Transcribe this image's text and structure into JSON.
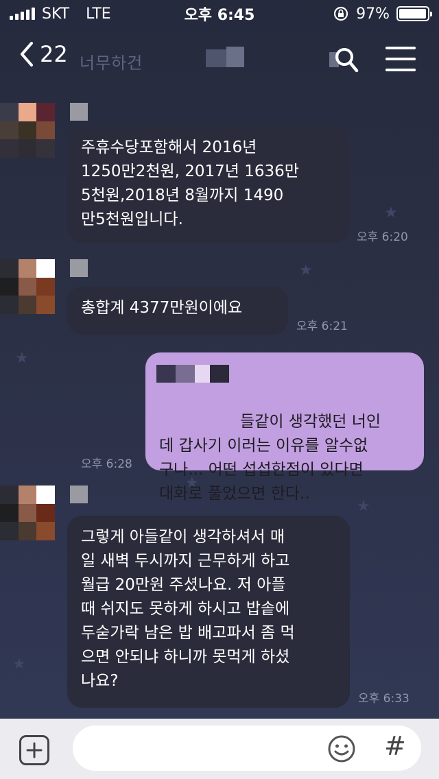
{
  "status_bar": {
    "carrier": "SKT",
    "network": "LTE",
    "time": "오후 6:45",
    "battery_label": "97%",
    "battery_level": 0.97
  },
  "nav": {
    "back_count": "22",
    "title": "너무하건"
  },
  "messages": [
    {
      "direction": "incoming",
      "text": "주휴수당포함해서 2016년\n1250만2천원, 2017년 1636만\n5천원,2018년 8월까지 1490\n만5천원입니다.",
      "time": "오후 6:20"
    },
    {
      "direction": "incoming",
      "text": "총합계 4377만원이에요",
      "time": "오후 6:21"
    },
    {
      "direction": "outgoing",
      "text": "들같이 생각했던 너인\n데 갑사기 이러는 이유를 알수없\n구나... 어떤 섭섭한점이 있다면\n대화로 풀었으면 한다..",
      "time": "오후 6:28"
    },
    {
      "direction": "incoming",
      "text": "그렇게 아들같이 생각하셔서 매\n일 새벽 두시까지 근무하게 하고\n월급 20만원 주셨나요. 저 아플\n때 쉬지도 못하게 하시고 밥솥에\n두숟가락 남은 밥 배고파서 좀 먹\n으면 안되냐 하니까 못먹게 하셨\n나요?",
      "time": "오후 6:33"
    }
  ],
  "input_bar": {
    "plus_icon": "plus-icon",
    "emoji_icon": "emoji-icon",
    "hash_label": "#"
  },
  "colors": {
    "background": "#2b3045",
    "incoming_bubble": "#2a2c3b",
    "outgoing_bubble": "#c29fe0",
    "input_bar": "#ececf0"
  }
}
